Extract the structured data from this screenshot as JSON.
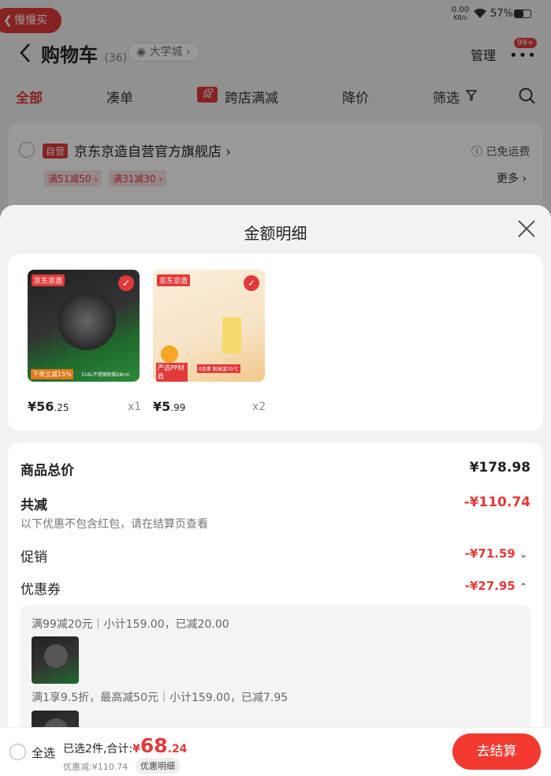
{
  "status_bar": {
    "speed_value": "0.00",
    "speed_unit": "KB/s",
    "battery": "57%"
  },
  "back_pill": {
    "label": "慢慢买"
  },
  "header": {
    "title": "购物车",
    "count": "(36)",
    "location": "大学城",
    "manage": "管理",
    "badge": "99+"
  },
  "tabs": [
    {
      "label": "全部"
    },
    {
      "label": "凑单"
    },
    {
      "label": "跨店满减",
      "icon": "促"
    },
    {
      "label": "降价"
    },
    {
      "label": "筛选"
    }
  ],
  "store": {
    "badge": "自营",
    "name": "京东京造自营官方旗舰店",
    "shipping": "已免运费",
    "tags": [
      "满51减50",
      "满31减30"
    ],
    "more": "更多"
  },
  "sheet": {
    "title": "金额明细",
    "products": [
      {
        "brand": "京东京造",
        "price_int": "¥56",
        "price_dec": ".25",
        "qty": "x1",
        "promo": "下单立减15%",
        "thumb_text": "316L不锈钢煎锅28cm"
      },
      {
        "brand": "京东京造",
        "price_int": "¥5",
        "price_dec": ".99",
        "qty": "x2",
        "promo": "严选PP材质",
        "thumb_text": "0色素 耐高温70°C"
      }
    ],
    "total_label": "商品总价",
    "total_value": "¥178.98",
    "discount_label": "共减",
    "discount_value": "-¥110.74",
    "discount_note": "以下优惠不包含红包，请在结算页查看",
    "promo_label": "促销",
    "promo_value": "-¥71.59",
    "coupon_label": "优惠券",
    "coupon_value": "-¥27.95",
    "coupon_details": [
      "满99减20元｜小计159.00，已减20.00",
      "满1享9.5折，最高减50元｜小计159.00，已减7.95"
    ]
  },
  "bottom_bar": {
    "select_all": "全选",
    "selected": "已选2件,合计:",
    "currency": "¥",
    "total_int": "68",
    "total_dec": ".24",
    "saved": "优惠减:¥110.74",
    "detail_btn": "优惠明细",
    "checkout": "去结算"
  },
  "colors": {
    "accent": "#e23a3a",
    "checkout": "#f23a31"
  }
}
